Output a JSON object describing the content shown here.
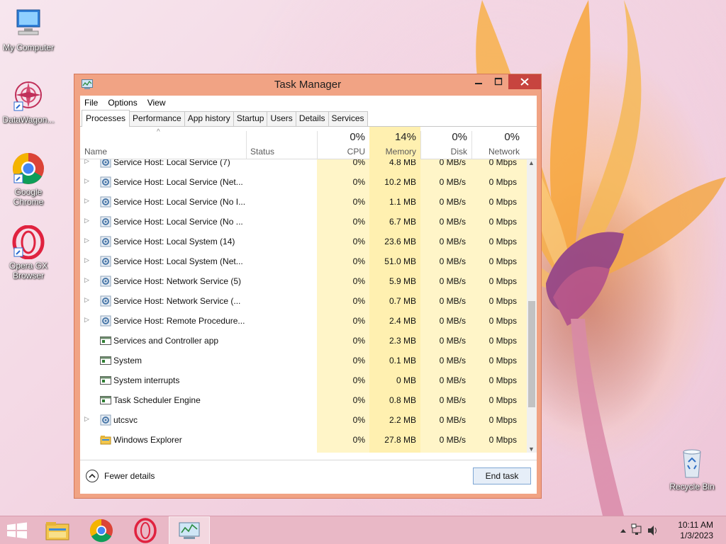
{
  "desktop": {
    "icons": [
      {
        "label": "My Computer"
      },
      {
        "label": "DataWagon..."
      },
      {
        "label": "Google Chrome"
      },
      {
        "label": "Opera GX Browser"
      },
      {
        "label": "Recycle Bin"
      }
    ]
  },
  "window": {
    "title": "Task Manager",
    "menu": [
      "File",
      "Options",
      "View"
    ],
    "tabs": [
      "Processes",
      "Performance",
      "App history",
      "Startup",
      "Users",
      "Details",
      "Services"
    ],
    "active_tab": "Processes",
    "columns": {
      "name": "Name",
      "status": "Status",
      "cpu": {
        "label": "CPU",
        "percent": "0%"
      },
      "memory": {
        "label": "Memory",
        "percent": "14%"
      },
      "disk": {
        "label": "Disk",
        "percent": "0%"
      },
      "network": {
        "label": "Network",
        "percent": "0%"
      }
    },
    "sort_indicator": "^",
    "processes": [
      {
        "name": "Service Host: Local Service (7)",
        "cpu": "0%",
        "memory": "4.8 MB",
        "disk": "0 MB/s",
        "network": "0 Mbps",
        "expandable": true,
        "icon": "gear"
      },
      {
        "name": "Service Host: Local Service (Net...",
        "cpu": "0%",
        "memory": "10.2 MB",
        "disk": "0 MB/s",
        "network": "0 Mbps",
        "expandable": true,
        "icon": "gear"
      },
      {
        "name": "Service Host: Local Service (No I...",
        "cpu": "0%",
        "memory": "1.1 MB",
        "disk": "0 MB/s",
        "network": "0 Mbps",
        "expandable": true,
        "icon": "gear"
      },
      {
        "name": "Service Host: Local Service (No ...",
        "cpu": "0%",
        "memory": "6.7 MB",
        "disk": "0 MB/s",
        "network": "0 Mbps",
        "expandable": true,
        "icon": "gear"
      },
      {
        "name": "Service Host: Local System (14)",
        "cpu": "0%",
        "memory": "23.6 MB",
        "disk": "0 MB/s",
        "network": "0 Mbps",
        "expandable": true,
        "icon": "gear"
      },
      {
        "name": "Service Host: Local System (Net...",
        "cpu": "0%",
        "memory": "51.0 MB",
        "disk": "0 MB/s",
        "network": "0 Mbps",
        "expandable": true,
        "icon": "gear"
      },
      {
        "name": "Service Host: Network Service (5)",
        "cpu": "0%",
        "memory": "5.9 MB",
        "disk": "0 MB/s",
        "network": "0 Mbps",
        "expandable": true,
        "icon": "gear"
      },
      {
        "name": "Service Host: Network Service (...",
        "cpu": "0%",
        "memory": "0.7 MB",
        "disk": "0 MB/s",
        "network": "0 Mbps",
        "expandable": true,
        "icon": "gear"
      },
      {
        "name": "Service Host: Remote Procedure...",
        "cpu": "0%",
        "memory": "2.4 MB",
        "disk": "0 MB/s",
        "network": "0 Mbps",
        "expandable": true,
        "icon": "gear"
      },
      {
        "name": "Services and Controller app",
        "cpu": "0%",
        "memory": "2.3 MB",
        "disk": "0 MB/s",
        "network": "0 Mbps",
        "expandable": false,
        "icon": "window"
      },
      {
        "name": "System",
        "cpu": "0%",
        "memory": "0.1 MB",
        "disk": "0 MB/s",
        "network": "0 Mbps",
        "expandable": false,
        "icon": "window"
      },
      {
        "name": "System interrupts",
        "cpu": "0%",
        "memory": "0 MB",
        "disk": "0 MB/s",
        "network": "0 Mbps",
        "expandable": false,
        "icon": "window"
      },
      {
        "name": "Task Scheduler Engine",
        "cpu": "0%",
        "memory": "0.8 MB",
        "disk": "0 MB/s",
        "network": "0 Mbps",
        "expandable": false,
        "icon": "window"
      },
      {
        "name": "utcsvc",
        "cpu": "0%",
        "memory": "2.2 MB",
        "disk": "0 MB/s",
        "network": "0 Mbps",
        "expandable": true,
        "icon": "gear"
      },
      {
        "name": "Windows Explorer",
        "cpu": "0%",
        "memory": "27.8 MB",
        "disk": "0 MB/s",
        "network": "0 Mbps",
        "expandable": false,
        "icon": "folder"
      }
    ],
    "footer": {
      "fewer_details": "Fewer details",
      "end_task": "End task"
    }
  },
  "taskbar": {
    "clock_time": "10:11 AM",
    "clock_date": "1/3/2023",
    "pinned": [
      "windows-start-icon",
      "file-explorer-icon",
      "chrome-icon",
      "opera-icon",
      "task-manager-icon"
    ]
  },
  "colors": {
    "window_frame": "#f1a384",
    "close_button": "#c7443f",
    "cpu_column": "#fff5c8",
    "memory_column": "#fff0b0",
    "taskbar": "#e9b8c6"
  }
}
